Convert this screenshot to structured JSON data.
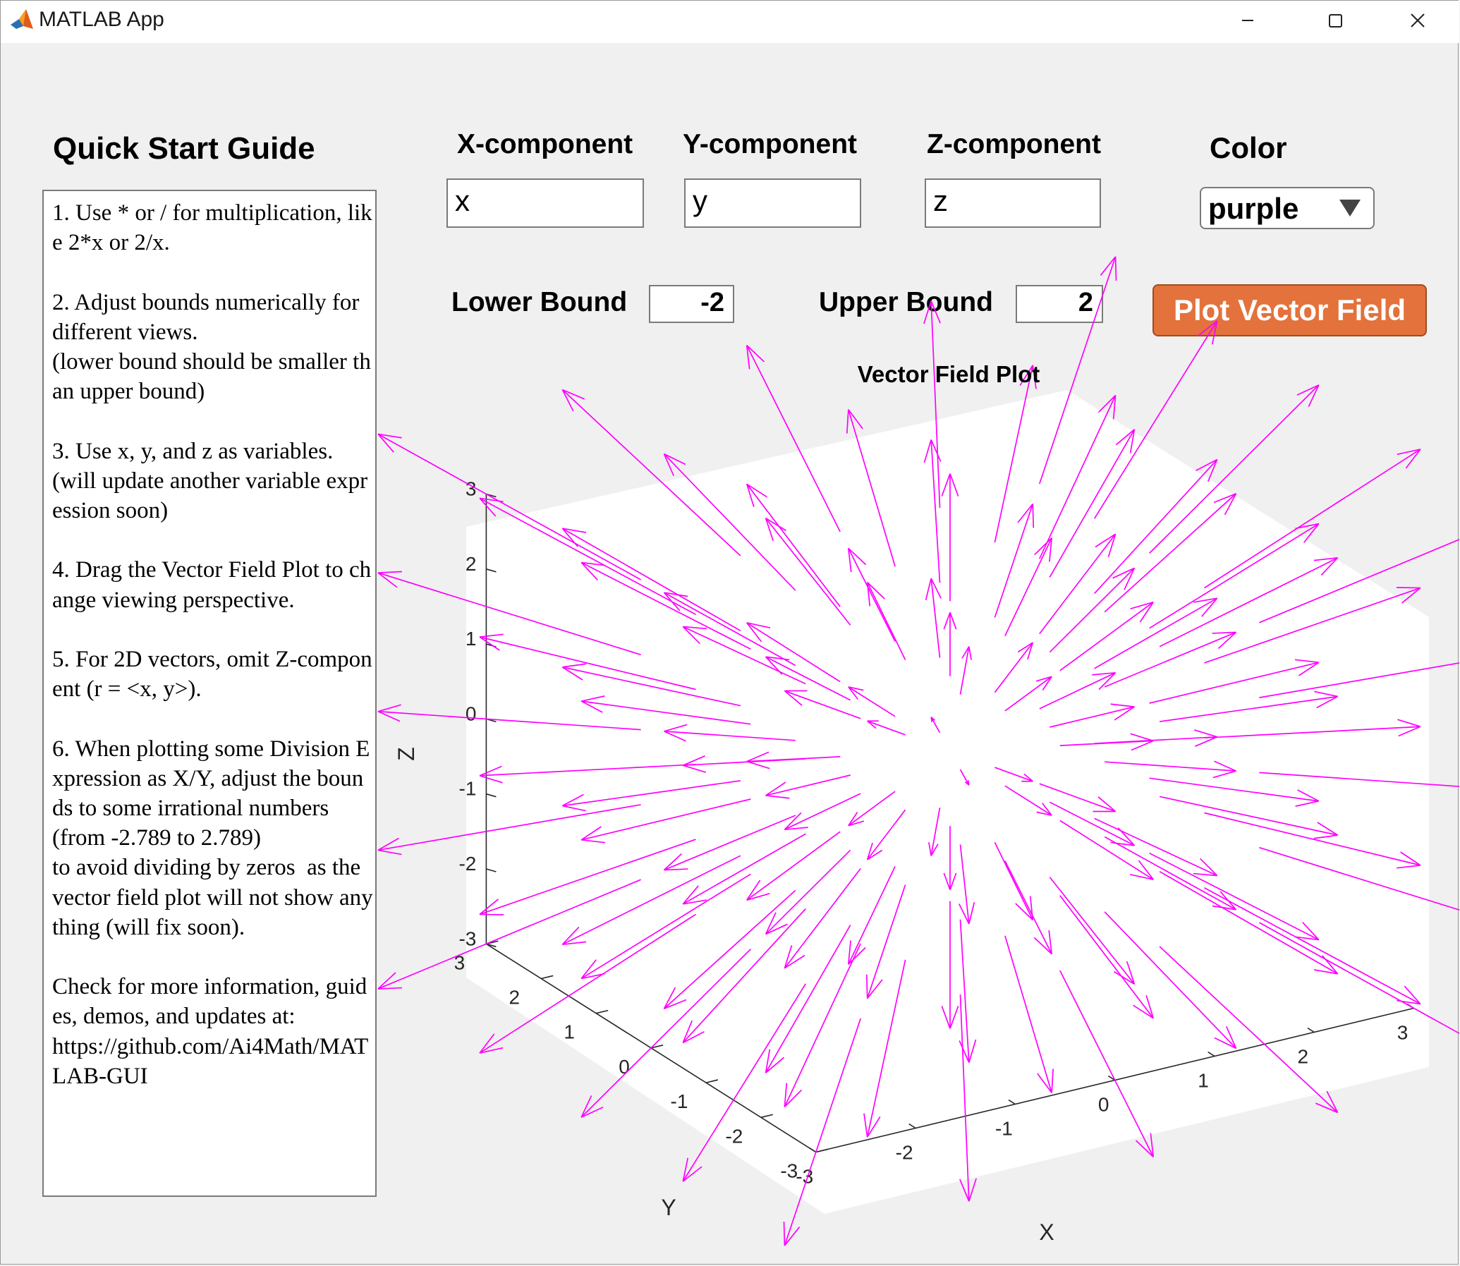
{
  "window": {
    "title": "MATLAB App"
  },
  "guide": {
    "heading": "Quick Start Guide",
    "text": "1. Use * or / for multiplication, like 2*x or 2/x.\n\n2. Adjust bounds numerically for different views.\n(lower bound should be smaller than upper bound)\n\n3. Use x, y, and z as variables.\n(will update another variable expression soon)\n\n4. Drag the Vector Field Plot to change viewing perspective.\n\n5. For 2D vectors, omit Z-component (r = <x, y>).\n\n6. When plotting some Division Expression as X/Y, adjust the bounds to some irrational numbers\n(from -2.789 to 2.789)\nto avoid dividing by zeros  as the vector field plot will not show anything (will fix soon).\n\nCheck for more information, guides, demos, and updates at:\nhttps://github.com/Ai4Math/MATLAB-GUI"
  },
  "inputs": {
    "x_label": "X-component",
    "x_value": "x",
    "y_label": "Y-component",
    "y_value": "y",
    "z_label": "Z-component",
    "z_value": "z",
    "color_label": "Color",
    "color_value": "purple",
    "lower_label": "Lower Bound",
    "lower_value": "-2",
    "upper_label": "Upper Bound",
    "upper_value": "2",
    "plot_button": "Plot Vector Field"
  },
  "colors": {
    "plot_button": "#e3723c",
    "arrow": "#ff00ff"
  },
  "chart_data": {
    "type": "quiver3",
    "title": "Vector Field Plot",
    "xlabel": "X",
    "ylabel": "Y",
    "zlabel": "Z",
    "xlim": [
      -3,
      3
    ],
    "ylim": [
      -3,
      3
    ],
    "zlim": [
      -3,
      3
    ],
    "xticks": [
      -3,
      -2,
      -1,
      0,
      1,
      2,
      3
    ],
    "yticks": [
      -3,
      -2,
      -1,
      0,
      1,
      2,
      3
    ],
    "zticks": [
      -3,
      -2,
      -1,
      0,
      1,
      2,
      3
    ],
    "field": {
      "u": "x",
      "v": "y",
      "w": "z"
    },
    "grid": [
      -2,
      -1,
      0,
      1,
      2
    ],
    "arrow_color": "#ff00ff",
    "arrow_scale": 0.85
  }
}
